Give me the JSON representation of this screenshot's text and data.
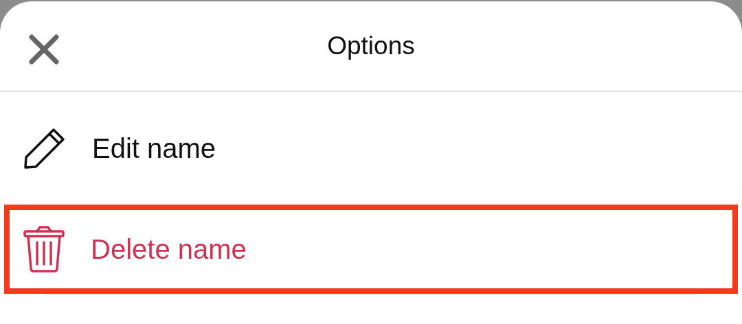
{
  "sheet": {
    "title": "Options"
  },
  "items": [
    {
      "label": "Edit name",
      "kind": "edit",
      "highlighted": false
    },
    {
      "label": "Delete name",
      "kind": "delete",
      "highlighted": true
    }
  ]
}
